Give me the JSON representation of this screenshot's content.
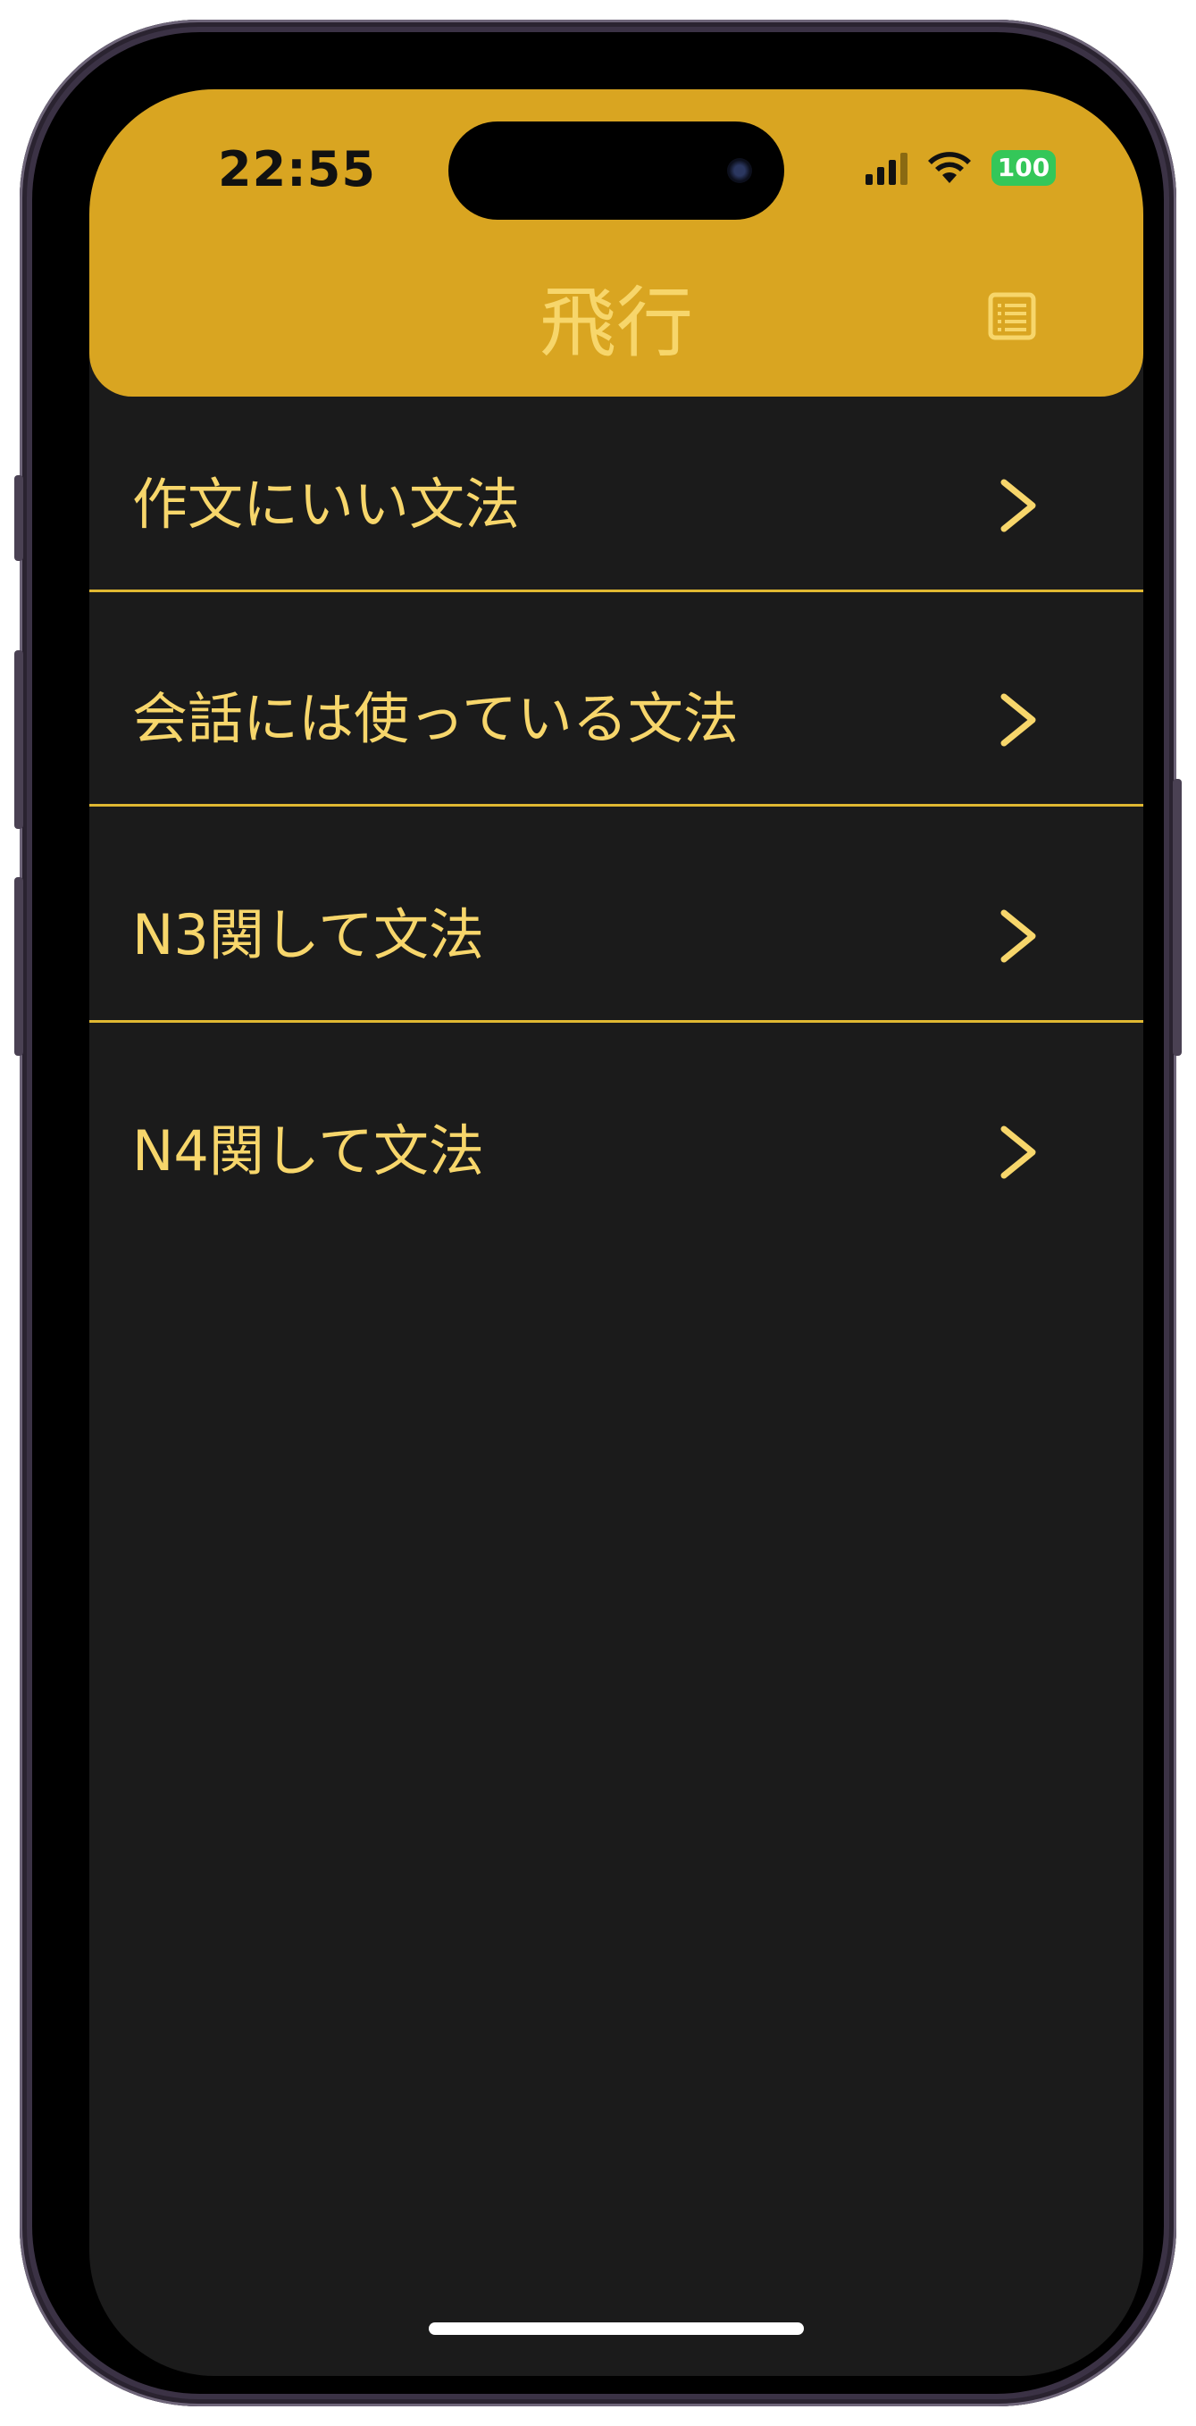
{
  "status_bar": {
    "time": "22:55",
    "battery": "100",
    "battery_color": "#34c759"
  },
  "header": {
    "title": "飛行",
    "background": "#d9a521",
    "accent": "#f7d66b",
    "right_icon": "list-icon"
  },
  "list": {
    "items": [
      {
        "label": "作文にいい文法"
      },
      {
        "label": "会話には使っている文法"
      },
      {
        "label": "N3関して文法"
      },
      {
        "label": "N4関して文法"
      }
    ],
    "chevron_icon": "chevron-right-icon",
    "divider_color": "#e0b832"
  },
  "screen": {
    "background": "#1b1b1b"
  }
}
